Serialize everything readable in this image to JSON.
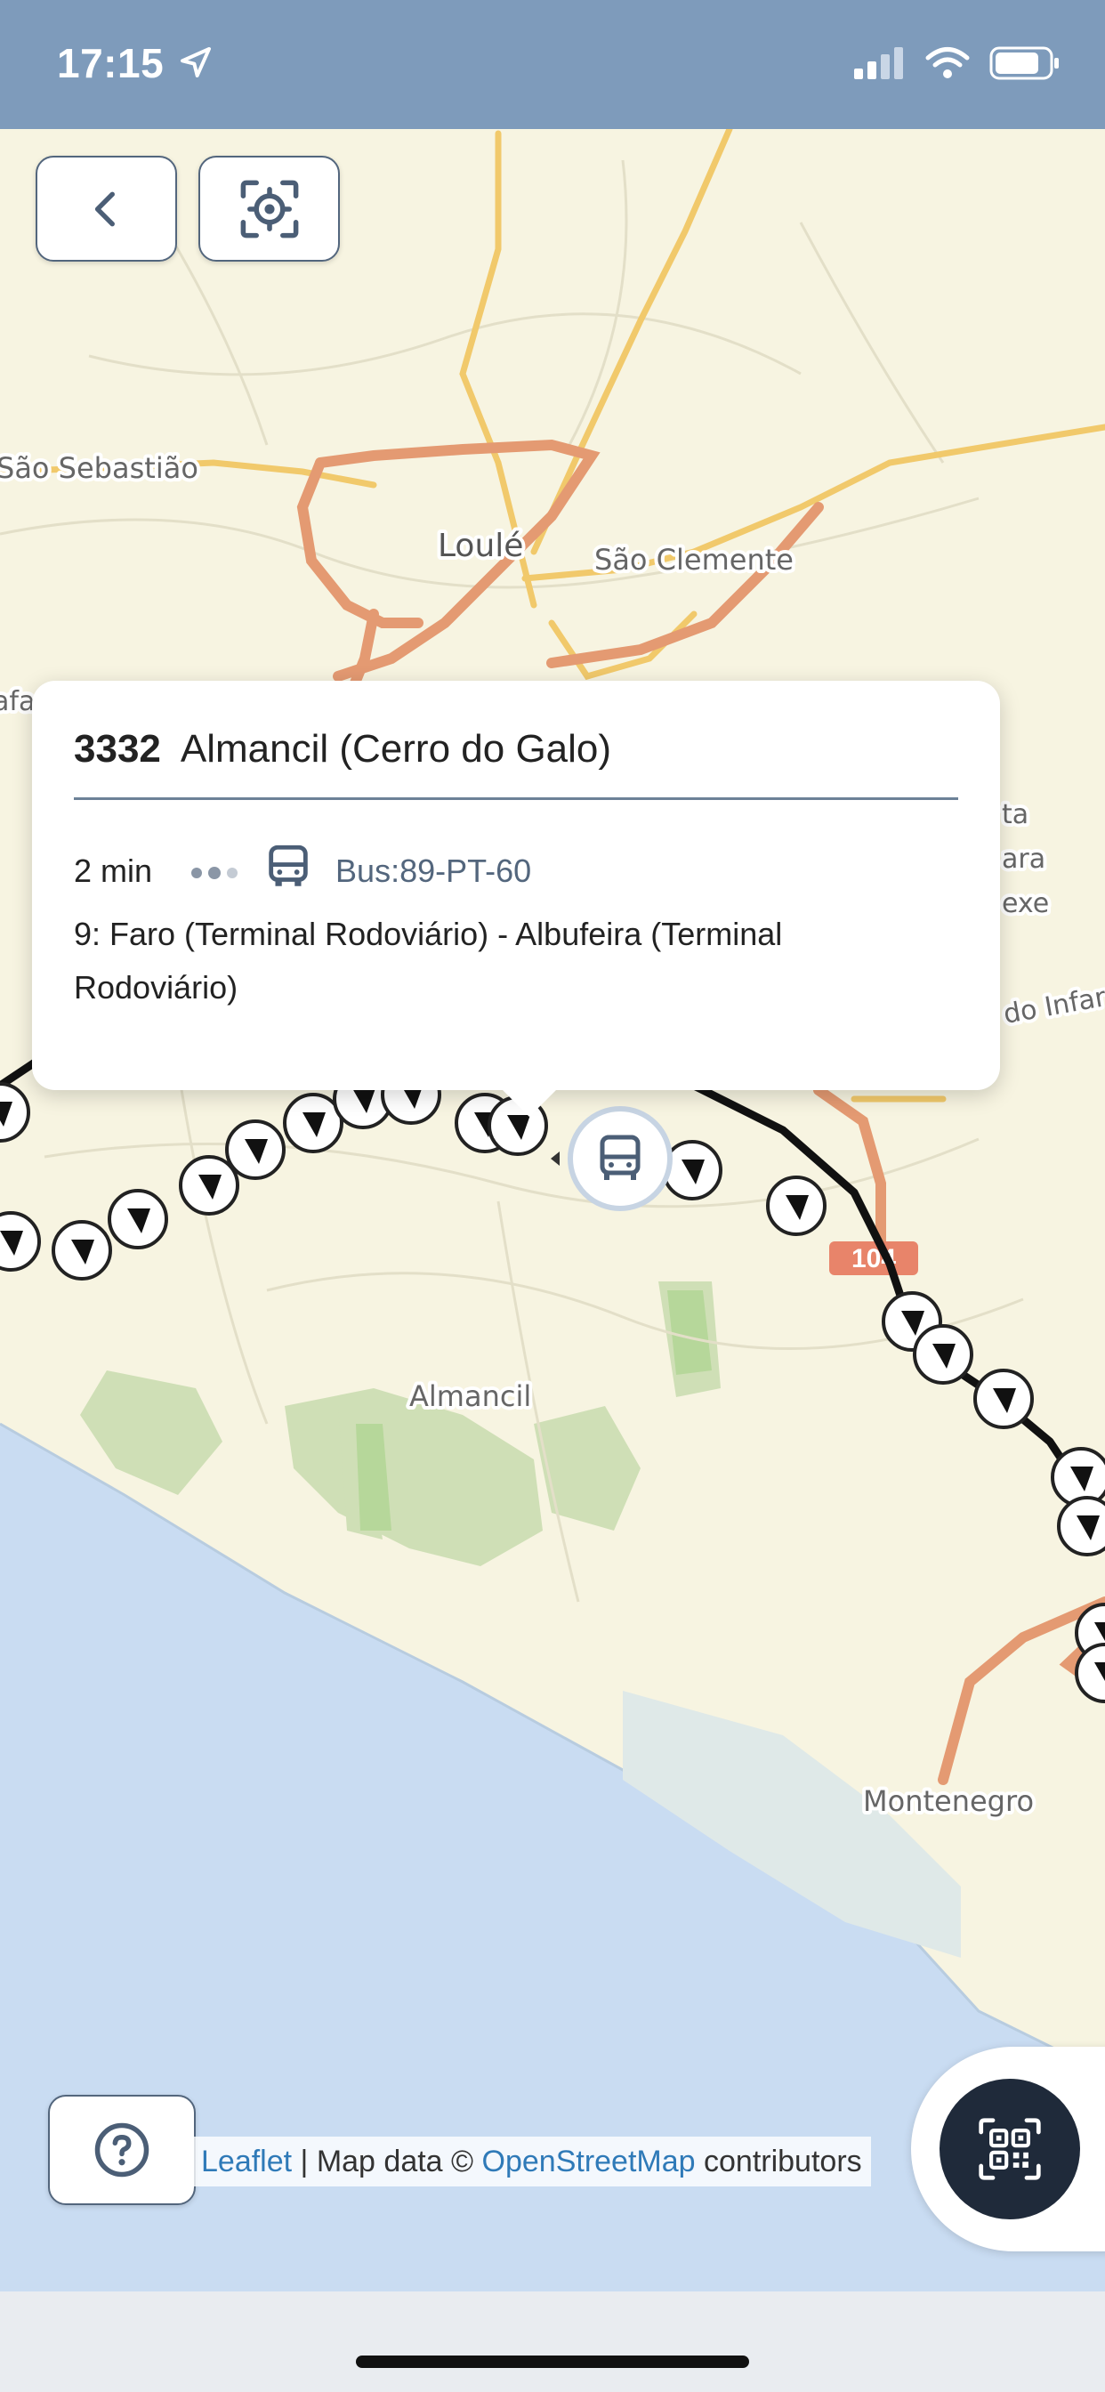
{
  "status_bar": {
    "time": "17:15"
  },
  "map": {
    "places": [
      {
        "name": "São Sebastião"
      },
      {
        "name": "Loulé"
      },
      {
        "name": "São Clemente"
      },
      {
        "name": "Almancil"
      },
      {
        "name": "Montenegro"
      },
      {
        "name": "ta"
      },
      {
        "name": "ara"
      },
      {
        "name": "exe"
      },
      {
        "name": "do Infar"
      },
      {
        "name": "afa"
      }
    ],
    "road_shield": "104"
  },
  "popup": {
    "stop_code": "3332",
    "stop_name": "Almancil (Cerro do Galo)",
    "eta": "2 min",
    "vehicle": "Bus:89-PT-60",
    "route": "9: Faro (Terminal Rodoviário) - Albufeira (Terminal Rodoviário)"
  },
  "attribution": {
    "leaflet": "Leaflet",
    "separator": " | Map data © ",
    "osm": "OpenStreetMap",
    "suffix": " contributors"
  },
  "colors": {
    "status_bar": "#7e9bbb",
    "accent": "#53667d",
    "land": "#f7f4e1",
    "water": "#c9dcf2",
    "route": "#111111"
  }
}
